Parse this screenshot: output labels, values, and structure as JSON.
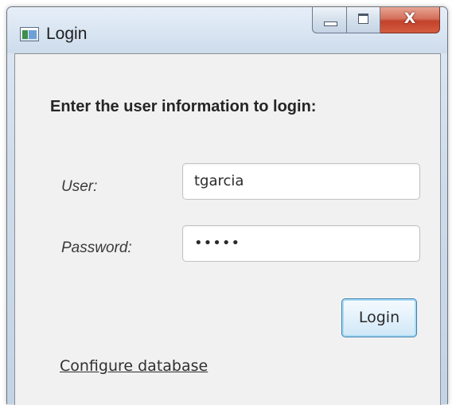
{
  "window": {
    "title": "Login"
  },
  "caption_buttons": {
    "minimize_icon": "minimize-icon",
    "maximize_icon": "maximize-icon",
    "close_glyph": "X"
  },
  "form": {
    "header": "Enter the user information to login:",
    "user_label": "User:",
    "user_value": "tgarcia",
    "password_label": "Password:",
    "password_value": "•••••",
    "login_button": "Login",
    "configure_link": "Configure database"
  },
  "colors": {
    "close_button": "#c2412a",
    "login_button_border": "#3c7fb1",
    "client_background": "#f1f1f1"
  }
}
